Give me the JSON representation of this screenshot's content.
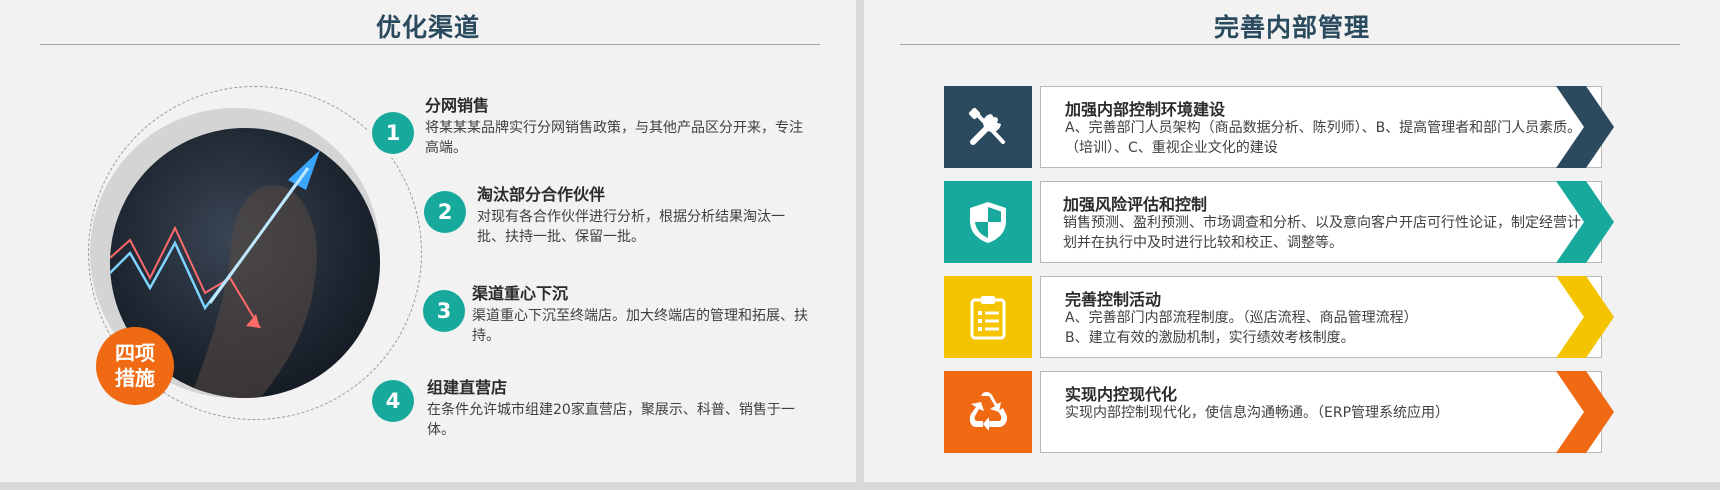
{
  "left": {
    "title": "优化渠道",
    "badge": "四项\n措施",
    "items": [
      {
        "num": "1",
        "title": "分网销售",
        "desc": "将某某某品牌实行分网销售政策，与其他产品区分开来，专注高端。"
      },
      {
        "num": "2",
        "title": "淘汰部分合作伙伴",
        "desc": "对现有各合作伙伴进行分析，根据分析结果淘汰一批、扶持一批、保留一批。"
      },
      {
        "num": "3",
        "title": "渠道重心下沉",
        "desc": "渠道重心下沉至终端店。加大终端店的管理和拓展、扶持。"
      },
      {
        "num": "4",
        "title": "组建直营店",
        "desc": "在条件允许城市组建20家直营店，聚展示、科普、销售于一体。"
      }
    ]
  },
  "right": {
    "title": "完善内部管理",
    "rows": [
      {
        "icon": "tools-icon",
        "color": "#2b4a5e",
        "title": "加强内部控制环境建设",
        "desc": "A、完善部门人员架构（商品数据分析、陈列师）、B、提高管理者和部门人员素质。（培训）、C、重视企业文化的建设"
      },
      {
        "icon": "shield-icon",
        "color": "#17a99b",
        "title": "加强风险评估和控制",
        "desc": "销售预测、盈利预测、市场调查和分析、以及意向客户开店可行性论证，制定经营计划并在执行中及时进行比较和校正、调整等。"
      },
      {
        "icon": "clipboard-icon",
        "color": "#f5c400",
        "title": "完善控制活动",
        "desc": "A、完善部门内部流程制度。（巡店流程、商品管理流程）\nB、建立有效的激励机制，实行绩效考核制度。"
      },
      {
        "icon": "recycle-icon",
        "color": "#ef6a12",
        "title": "实现内控现代化",
        "desc": "实现内部控制现代化，使信息沟通畅通。（ERP管理系统应用）"
      }
    ]
  }
}
